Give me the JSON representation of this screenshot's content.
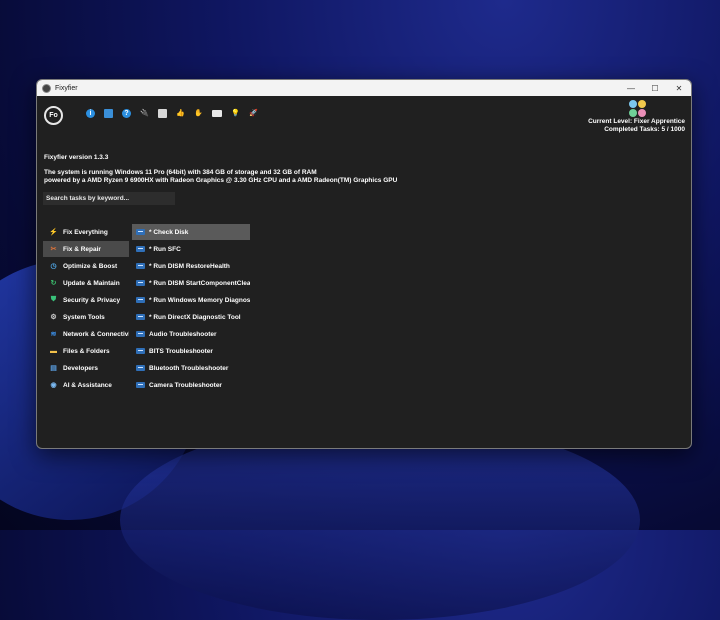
{
  "window": {
    "title": "Fixyfier",
    "minimize": "—",
    "maximize": "☐",
    "close": "✕"
  },
  "logo_text": "Fo",
  "toolbar": [
    {
      "icon": "info-icon",
      "glyph": "i"
    },
    {
      "icon": "document-icon",
      "glyph": ""
    },
    {
      "icon": "help-icon",
      "glyph": "?"
    },
    {
      "icon": "plug-icon",
      "glyph": "🔌"
    },
    {
      "icon": "shopping-bag-icon",
      "glyph": ""
    },
    {
      "icon": "thumbs-up-icon",
      "glyph": "👍"
    },
    {
      "icon": "donate-hand-icon",
      "glyph": "✋"
    },
    {
      "icon": "id-card-icon",
      "glyph": ""
    },
    {
      "icon": "lightbulb-icon",
      "glyph": "💡"
    },
    {
      "icon": "rocket-icon",
      "glyph": "🚀"
    }
  ],
  "level": {
    "current": "Current Level: Fixer Apprentice",
    "completed": "Completed Tasks: 5 / 1000",
    "icon_colors": [
      "#7cc8ee",
      "#f2c94c",
      "#6fcf97",
      "#eb8fb8"
    ]
  },
  "version": "Fixyfier version 1.3.3",
  "system_info": {
    "line1": "The system is running Windows 11 Pro (64bit) with 384 GB of storage and 32 GB of RAM",
    "line2": "powered by a AMD Ryzen 9 6900HX with Radeon Graphics @ 3.30 GHz CPU and a AMD Radeon(TM) Graphics GPU"
  },
  "search": {
    "placeholder": "Search tasks by keyword..."
  },
  "categories": [
    {
      "label": "Fix Everything",
      "icon": "lightning-icon",
      "glyph": "⚡",
      "color": "#f2b632",
      "active": false
    },
    {
      "label": "Fix & Repair",
      "icon": "tools-icon",
      "glyph": "✂",
      "color": "#d9723a",
      "active": true
    },
    {
      "label": "Optimize & Boost",
      "icon": "speedometer-icon",
      "glyph": "◷",
      "color": "#4fa3e0",
      "active": false
    },
    {
      "label": "Update & Maintain",
      "icon": "update-icon",
      "glyph": "↻",
      "color": "#3bbf6e",
      "active": false
    },
    {
      "label": "Security & Privacy",
      "icon": "shield-icon",
      "glyph": "⛊",
      "color": "#39c27a",
      "active": false
    },
    {
      "label": "System Tools",
      "icon": "gear-icon",
      "glyph": "⚙",
      "color": "#c8c8c8",
      "active": false
    },
    {
      "label": "Network & Connectivity",
      "icon": "wifi-icon",
      "glyph": "≋",
      "color": "#3b8fe8",
      "active": false
    },
    {
      "label": "Files & Folders",
      "icon": "folder-icon",
      "glyph": "▬",
      "color": "#f2c14a",
      "active": false
    },
    {
      "label": "Developers",
      "icon": "code-file-icon",
      "glyph": "▤",
      "color": "#5a9ee0",
      "active": false
    },
    {
      "label": "AI & Assistance",
      "icon": "ai-brain-icon",
      "glyph": "◉",
      "color": "#7ab8f0",
      "active": false
    }
  ],
  "tasks": [
    {
      "label": "* Check Disk",
      "active": true
    },
    {
      "label": "* Run SFC",
      "active": false
    },
    {
      "label": "* Run DISM RestoreHealth",
      "active": false
    },
    {
      "label": "* Run DISM StartComponentCleanup",
      "active": false
    },
    {
      "label": "* Run Windows Memory Diagnostic",
      "active": false
    },
    {
      "label": "* Run DirectX Diagnostic Tool",
      "active": false
    },
    {
      "label": "Audio Troubleshooter",
      "active": false
    },
    {
      "label": "BITS Troubleshooter",
      "active": false
    },
    {
      "label": "Bluetooth Troubleshooter",
      "active": false
    },
    {
      "label": "Camera Troubleshooter",
      "active": false
    }
  ]
}
